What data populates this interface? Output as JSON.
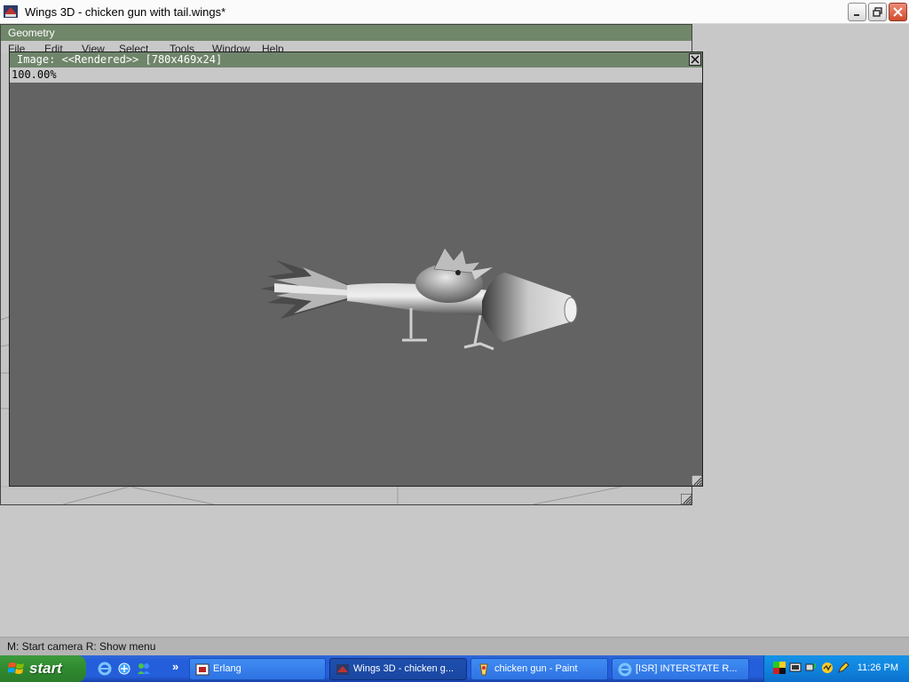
{
  "window": {
    "title": "Wings 3D - chicken gun with tail.wings*",
    "minimize_icon": "minimize-icon",
    "restore_icon": "restore-icon",
    "close_icon": "close-icon"
  },
  "geometry_window": {
    "title": "Geometry",
    "menu": [
      "File",
      "Edit",
      "View",
      "Select",
      "Tools",
      "Window",
      "Help"
    ]
  },
  "image_window": {
    "title": "Image: <<Rendered>> [780x469x24]",
    "zoom": "100.00%",
    "close_label": "X"
  },
  "statusbar": {
    "text": "M: Start camera   R: Show menu"
  },
  "taskbar": {
    "start_label": "start",
    "quick_launch": [
      "ie-icon",
      "outlook-icon",
      "msn-icon"
    ],
    "chevron": "»",
    "tasks": [
      {
        "label": "Erlang",
        "icon": "erlang-icon",
        "active": false
      },
      {
        "label": "Wings 3D - chicken g...",
        "icon": "wings-icon",
        "active": true
      },
      {
        "label": "chicken gun - Paint",
        "icon": "paint-icon",
        "active": false
      },
      {
        "label": "[ISR] INTERSTATE R...",
        "icon": "ie-icon",
        "active": false
      }
    ],
    "tray_icons": [
      "color-icon",
      "display-icon",
      "network-icon",
      "volume-icon",
      "pen-icon"
    ],
    "clock": "11:26 PM"
  },
  "colors": {
    "window_title_green": "#70876a",
    "render_background": "#636363",
    "taskbar_blue": "#245edb",
    "start_green": "#2f8a2f"
  }
}
